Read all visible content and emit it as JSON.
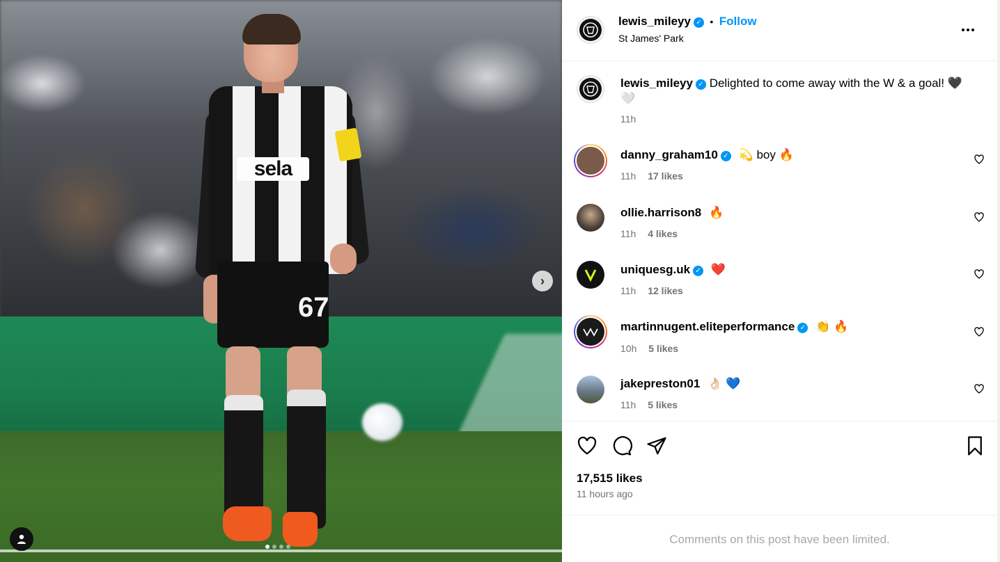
{
  "post": {
    "author": "lewis_mileyy",
    "verified": true,
    "location": "St James' Park",
    "follow_label": "Follow",
    "separator": "•",
    "more_icon": "more-horizontal-icon",
    "photo": {
      "jersey_sponsor": "sela",
      "jersey_number": "67",
      "carousel_dots": 4,
      "active_dot": 1
    }
  },
  "caption": {
    "author": "lewis_mileyy",
    "text": "Delighted to come away with the W & a goal! 🖤",
    "second_line": "🤍",
    "time": "11h"
  },
  "comments": [
    {
      "user": "danny_graham10",
      "verified": true,
      "text": "💫 boy 🔥",
      "time": "11h",
      "likes": "17 likes",
      "story_ring": true,
      "avatar_color": "#7a5a48"
    },
    {
      "user": "ollie.harrison8",
      "verified": false,
      "text": "🔥",
      "time": "11h",
      "likes": "4 likes",
      "story_ring": false,
      "avatar_color": "#4a4038"
    },
    {
      "user": "uniquesg.uk",
      "verified": true,
      "text": "❤️",
      "time": "11h",
      "likes": "12 likes",
      "story_ring": false,
      "avatar_color": "#111111"
    },
    {
      "user": "martinnugent.eliteperformance",
      "verified": true,
      "text": "👏 🔥",
      "time": "10h",
      "likes": "5 likes",
      "story_ring": true,
      "avatar_color": "#1a1a1a"
    },
    {
      "user": "jakepreston01",
      "verified": false,
      "text": "👌🏻 💙",
      "time": "11h",
      "likes": "5 likes",
      "story_ring": false,
      "avatar_color": "#6a7a8a"
    }
  ],
  "actions": {
    "likes": "17,515 likes",
    "time_ago": "11 hours ago"
  },
  "footer": {
    "limited_text": "Comments on this post have been limited."
  },
  "colors": {
    "accent": "#0095f6",
    "muted": "#737373",
    "limited": "#a8a8a8"
  }
}
